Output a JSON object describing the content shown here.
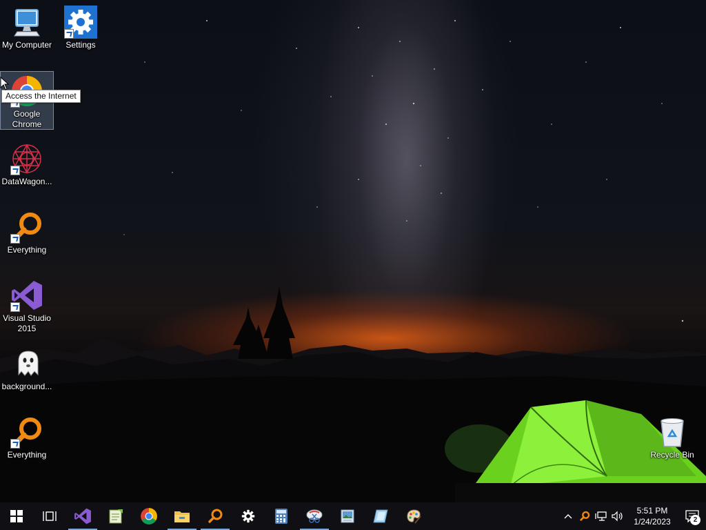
{
  "desktop": {
    "icons": [
      {
        "label": "My Computer",
        "icon": "computer-icon"
      },
      {
        "label": "Settings",
        "icon": "settings-gear-icon"
      },
      {
        "label": "Google Chrome",
        "icon": "chrome-icon"
      },
      {
        "label": "DataWagon...",
        "icon": "datawagon-icon"
      },
      {
        "label": "Everything",
        "icon": "everything-search-icon"
      },
      {
        "label": "Visual Studio 2015",
        "icon": "visual-studio-icon"
      },
      {
        "label": "background...",
        "icon": "ghost-icon"
      },
      {
        "label": "Everything",
        "icon": "everything-search-icon"
      },
      {
        "label": "Recycle Bin",
        "icon": "recycle-bin-icon"
      }
    ],
    "tooltip": "Access the Internet"
  },
  "taskbar": {
    "items": [
      {
        "icon": "windows-start-icon",
        "running": false
      },
      {
        "icon": "task-view-icon",
        "running": false
      },
      {
        "icon": "visual-studio-icon",
        "running": true
      },
      {
        "icon": "notepad-plus-icon",
        "running": false
      },
      {
        "icon": "chrome-icon",
        "running": false
      },
      {
        "icon": "file-explorer-icon",
        "running": true
      },
      {
        "icon": "everything-search-icon",
        "running": true
      },
      {
        "icon": "settings-gear-icon",
        "running": false
      },
      {
        "icon": "calculator-icon",
        "running": false
      },
      {
        "icon": "snipping-tool-icon",
        "running": true
      },
      {
        "icon": "image-viewer-icon",
        "running": false
      },
      {
        "icon": "notebook-icon",
        "running": false
      },
      {
        "icon": "paint-icon",
        "running": false
      }
    ],
    "tray": {
      "icons": [
        "chevron-up-icon",
        "everything-tray-icon",
        "network-icon",
        "volume-icon"
      ],
      "time": "5:51 PM",
      "date": "1/24/2023",
      "notification_count": "2"
    }
  },
  "colors": {
    "taskbar_bg": "#101014",
    "running_indicator": "#7aa7d6",
    "tent_green": "#7fe02a",
    "horizon_orange": "#e65f14"
  }
}
